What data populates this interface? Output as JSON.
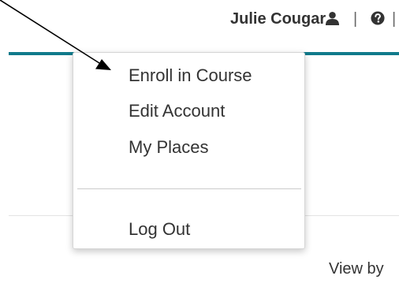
{
  "header": {
    "user_name": "Julie Cougar",
    "separator": "|",
    "user_icon": "user-icon",
    "help_icon": "question-circle-icon"
  },
  "user_menu": {
    "items": [
      {
        "label": "Enroll in Course"
      },
      {
        "label": "Edit Account"
      },
      {
        "label": "My Places"
      },
      {
        "label": "Log Out"
      }
    ]
  },
  "page": {
    "view_by_label": "View by"
  },
  "colors": {
    "accent_bar": "#117a8b",
    "text": "#333333"
  },
  "annotation": {
    "arrow_icon": "arrow-annotation-icon"
  }
}
